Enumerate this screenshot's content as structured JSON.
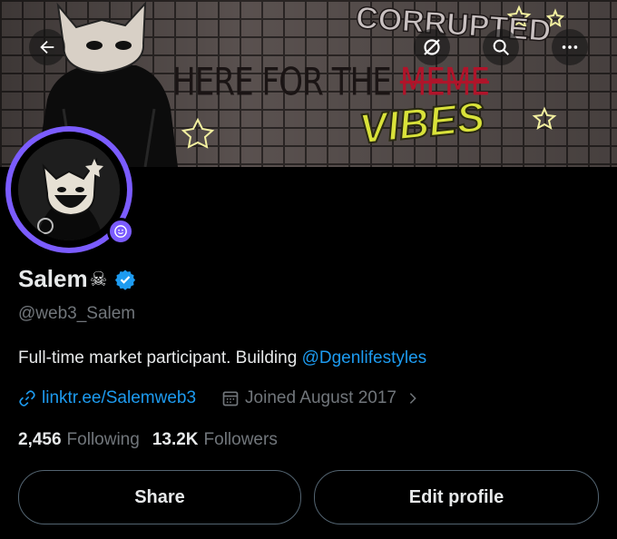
{
  "banner": {
    "line1_prefix": "HERE FOR THE",
    "line1_struck": "MEME",
    "line2": "VIBES",
    "graffiti": "CORRUPTED"
  },
  "header": {
    "back_icon": "arrow-left-icon",
    "grok_icon": "grok-icon",
    "search_icon": "search-icon",
    "more_icon": "more-horizontal-icon"
  },
  "profile": {
    "name": "Salem",
    "name_emoji": "☠",
    "verified_icon": "verified-badge-icon",
    "handle": "@web3_Salem",
    "bio_text": "Full-time market participant. Building ",
    "bio_mention": "@Dgenlifestyles",
    "link": "linktr.ee/Salemweb3",
    "joined": "Joined August 2017"
  },
  "stats": {
    "following_count": "2,456",
    "following_label": "Following",
    "followers_count": "13.2K",
    "followers_label": "Followers"
  },
  "actions": {
    "share_label": "Share",
    "edit_label": "Edit profile"
  },
  "colors": {
    "accent": "#1d9bf0",
    "avatar_ring": "#7b5cff",
    "background": "#000000",
    "muted_text": "#71767b"
  }
}
